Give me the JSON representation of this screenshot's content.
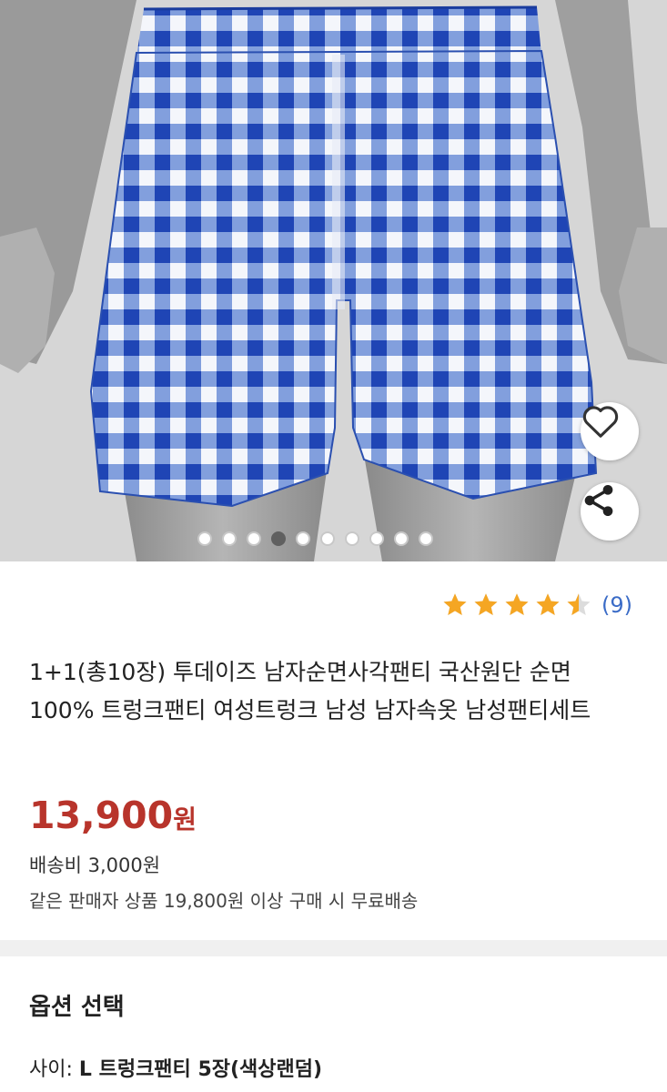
{
  "gallery": {
    "image_alt": "blue gingham check trunk boxer shorts",
    "total_images": 10,
    "active_index": 3
  },
  "rating": {
    "stars": 4.5,
    "review_count": "(9)",
    "star_color": "#f5a623"
  },
  "product": {
    "title": "1+1(총10장) 투데이즈 남자순면사각팬티 국산원단 순면100% 트렁크팬티 여성트렁크 남성 남자속옷 남성팬티세트",
    "price": "13,900",
    "currency": "원",
    "price_color": "#b8342b",
    "shipping_fee": "배송비 3,000원",
    "free_shipping_note": "같은 판매자 상품 19,800원 이상 구매 시 무료배송"
  },
  "options": {
    "title": "옵션 선택",
    "size_label": "사이:",
    "size_value": "L 트렁크팬티 5장(색상랜덤)"
  },
  "icons": {
    "wish": "heart-icon",
    "share": "share-icon"
  }
}
